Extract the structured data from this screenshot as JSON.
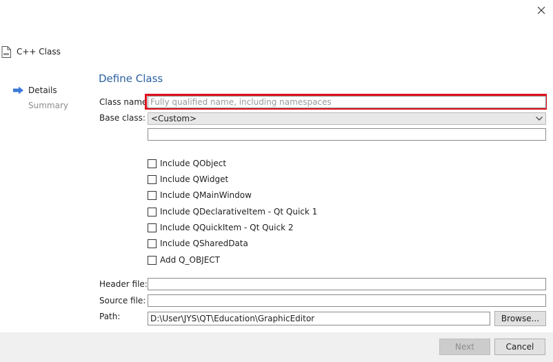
{
  "window": {
    "close_icon": "close-icon"
  },
  "wizard": {
    "title": "C++ Class",
    "icon": "file-icon"
  },
  "steps": [
    {
      "label": "Details",
      "current": true
    },
    {
      "label": "Summary",
      "current": false
    }
  ],
  "page_title": "Define Class",
  "form": {
    "class_name": {
      "label": "Class name:",
      "value": "",
      "placeholder": "Fully qualified name, including namespaces"
    },
    "base_class": {
      "label": "Base class:",
      "selected": "<Custom>"
    },
    "custom_base": {
      "value": ""
    },
    "checkboxes": [
      {
        "label": "Include QObject",
        "checked": false
      },
      {
        "label": "Include QWidget",
        "checked": false
      },
      {
        "label": "Include QMainWindow",
        "checked": false
      },
      {
        "label": "Include QDeclarativeItem - Qt Quick 1",
        "checked": false
      },
      {
        "label": "Include QQuickItem - Qt Quick 2",
        "checked": false
      },
      {
        "label": "Include QSharedData",
        "checked": false
      },
      {
        "label": "Add Q_OBJECT",
        "checked": false
      }
    ],
    "header_file": {
      "label": "Header file:",
      "value": ""
    },
    "source_file": {
      "label": "Source file:",
      "value": ""
    },
    "path": {
      "label": "Path:",
      "value": "D:\\User\\JYS\\QT\\Education\\GraphicEditor"
    },
    "browse_label": "Browse..."
  },
  "footer": {
    "next_label": "Next",
    "next_enabled": false,
    "cancel_label": "Cancel"
  },
  "colors": {
    "title_blue": "#2a5fa0",
    "highlight_red": "#e0101c",
    "arrow_blue": "#3c78d8"
  }
}
